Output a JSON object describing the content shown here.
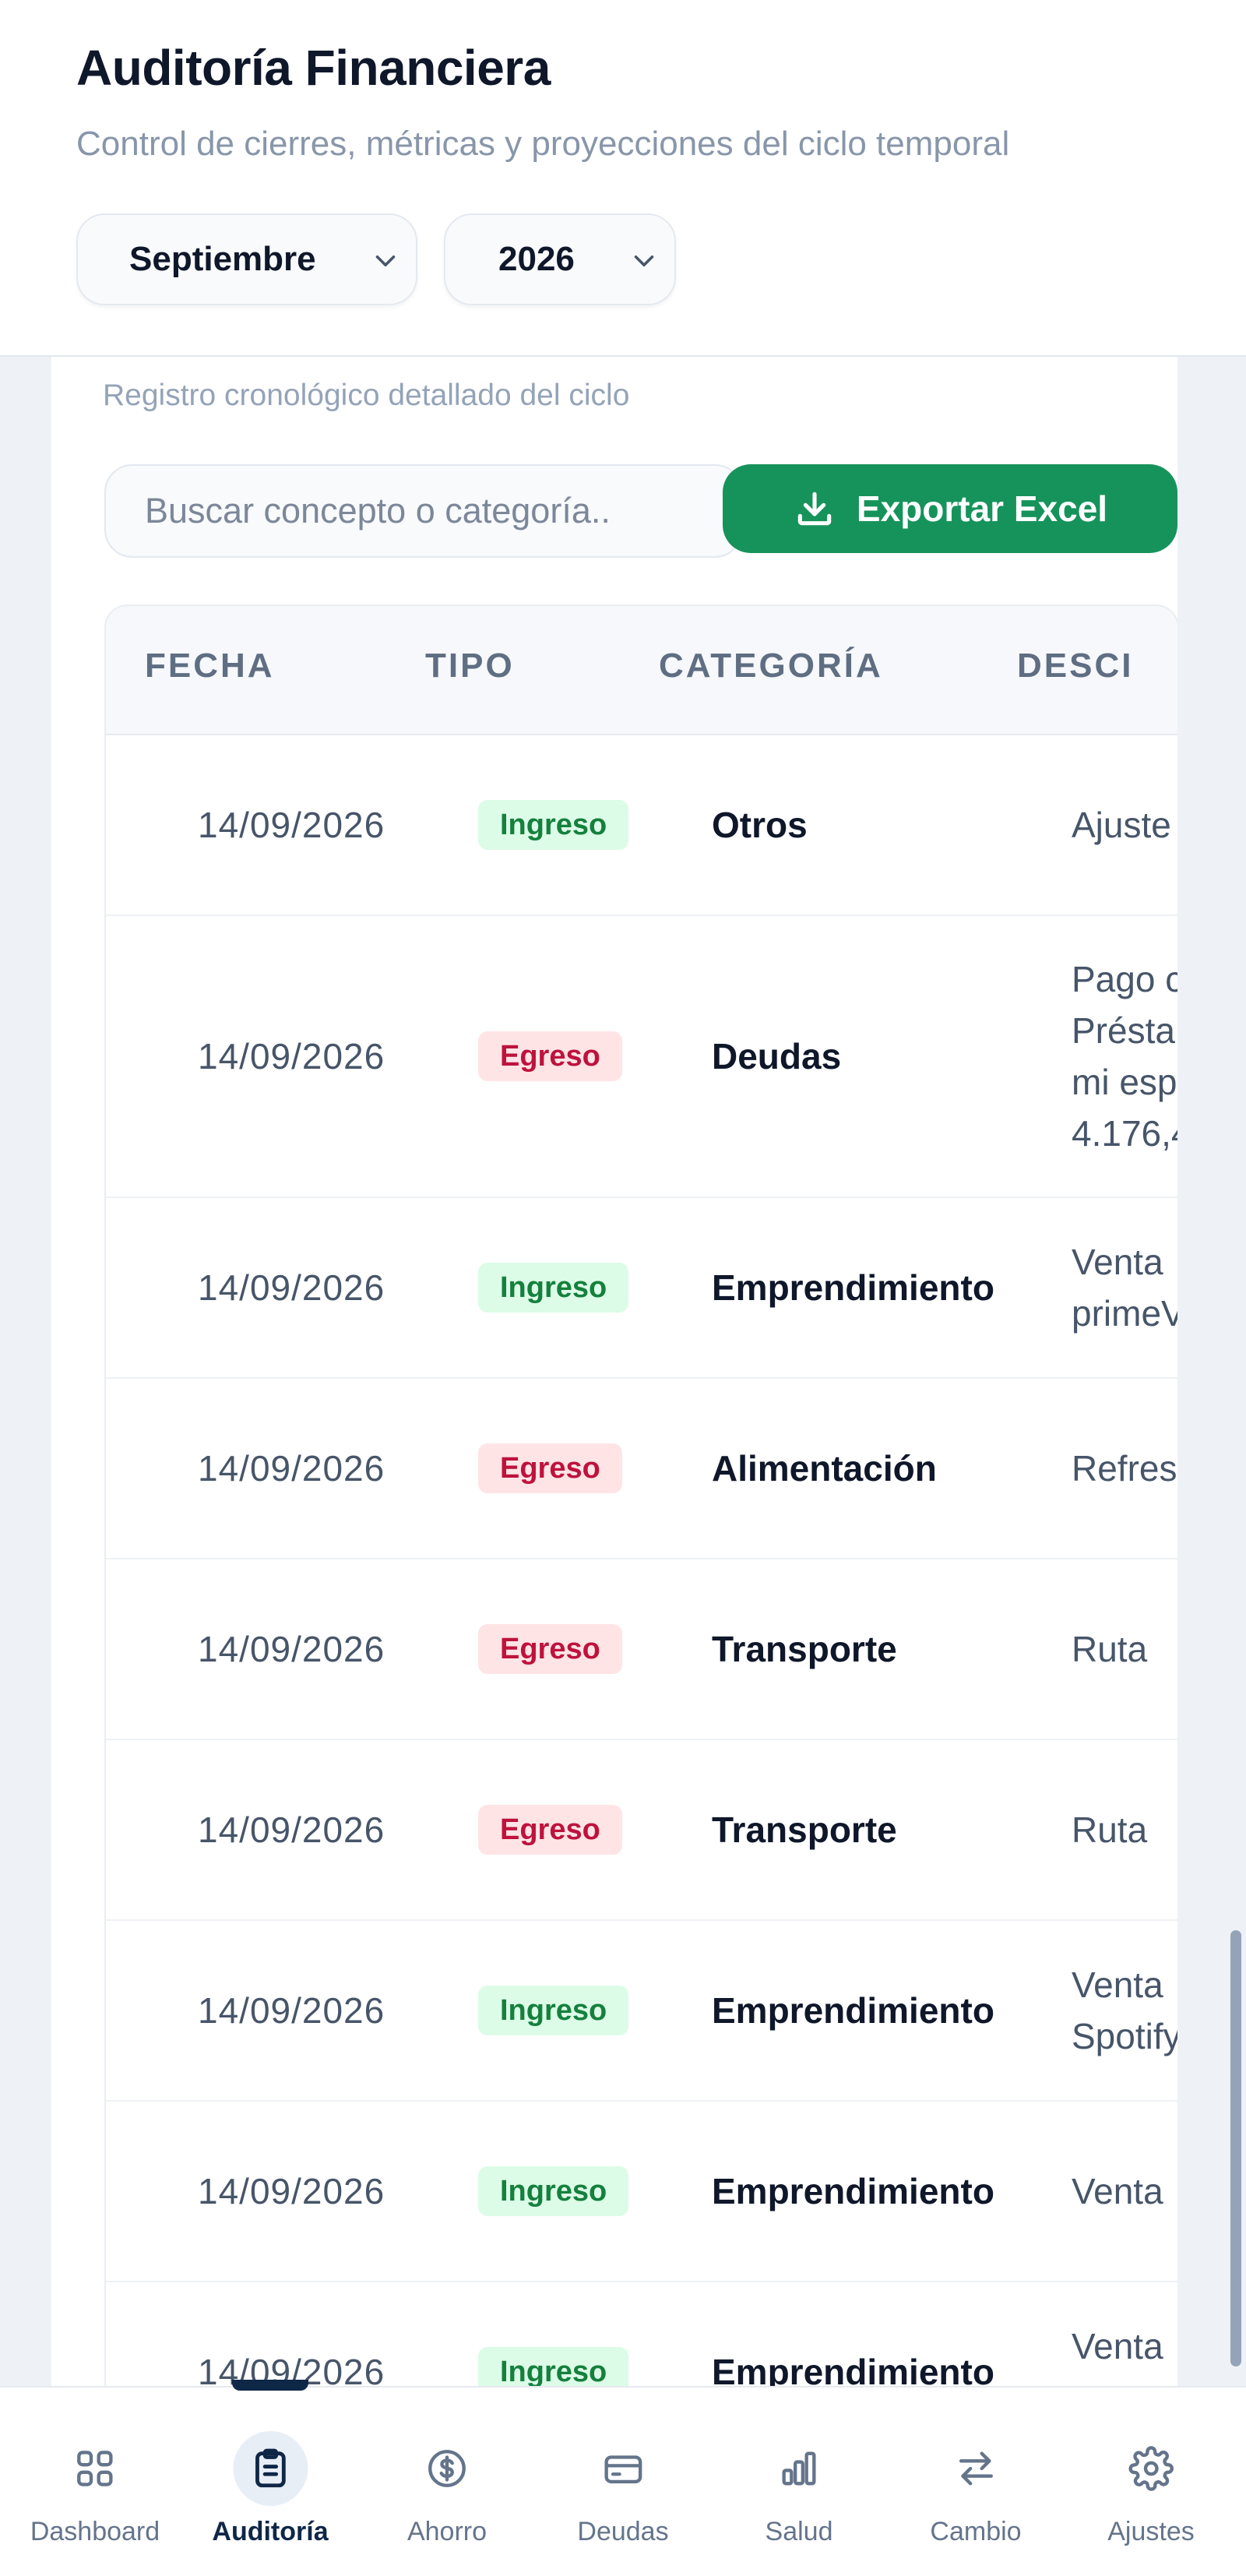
{
  "header": {
    "title": "Auditoría Financiera",
    "subtitle": "Control de cierres, métricas y proyecciones del ciclo temporal",
    "month_select": {
      "value": "Septiembre",
      "icon": "chevron-down-icon"
    },
    "year_select": {
      "value": "2026",
      "icon": "chevron-down-icon"
    }
  },
  "card": {
    "caption": "Registro cronológico detallado del ciclo",
    "search": {
      "placeholder": "Buscar concepto o categoría..",
      "value": ""
    },
    "export_button": {
      "label": "Exportar Excel",
      "icon": "download-icon",
      "color": "#16935b"
    }
  },
  "table": {
    "headers": {
      "date": "FECHA",
      "type": "TIPO",
      "category": "CATEGORÍA",
      "description": "DESCI"
    },
    "rows": [
      {
        "date": "14/09/2026",
        "type": "Ingreso",
        "category": "Otros",
        "description": "Ajuste"
      },
      {
        "date": "14/09/2026",
        "type": "Egreso",
        "category": "Deudas",
        "description": "Pago c\nPrésta\nmi esp\n4.176,4"
      },
      {
        "date": "14/09/2026",
        "type": "Ingreso",
        "category": "Emprendimiento",
        "description": "Venta\nprimeV"
      },
      {
        "date": "14/09/2026",
        "type": "Egreso",
        "category": "Alimentación",
        "description": "Refres"
      },
      {
        "date": "14/09/2026",
        "type": "Egreso",
        "category": "Transporte",
        "description": "Ruta"
      },
      {
        "date": "14/09/2026",
        "type": "Egreso",
        "category": "Transporte",
        "description": "Ruta"
      },
      {
        "date": "14/09/2026",
        "type": "Ingreso",
        "category": "Emprendimiento",
        "description": "Venta\nSpotify"
      },
      {
        "date": "14/09/2026",
        "type": "Ingreso",
        "category": "Emprendimiento",
        "description": "Venta"
      },
      {
        "date": "14/09/2026",
        "type": "Ingreso",
        "category": "Emprendimiento",
        "description": "Venta\notros"
      }
    ],
    "type_colors": {
      "Ingreso": "#15803d",
      "Egreso": "#be123c"
    }
  },
  "nav": {
    "active": "Auditoría",
    "items": [
      {
        "label": "Dashboard",
        "icon": "grid-icon"
      },
      {
        "label": "Auditoría",
        "icon": "clipboard-icon"
      },
      {
        "label": "Ahorro",
        "icon": "dollar-circle-icon"
      },
      {
        "label": "Deudas",
        "icon": "credit-card-icon"
      },
      {
        "label": "Salud",
        "icon": "bar-chart-icon"
      },
      {
        "label": "Cambio",
        "icon": "swap-arrows-icon"
      },
      {
        "label": "Ajustes",
        "icon": "gear-icon"
      }
    ]
  }
}
